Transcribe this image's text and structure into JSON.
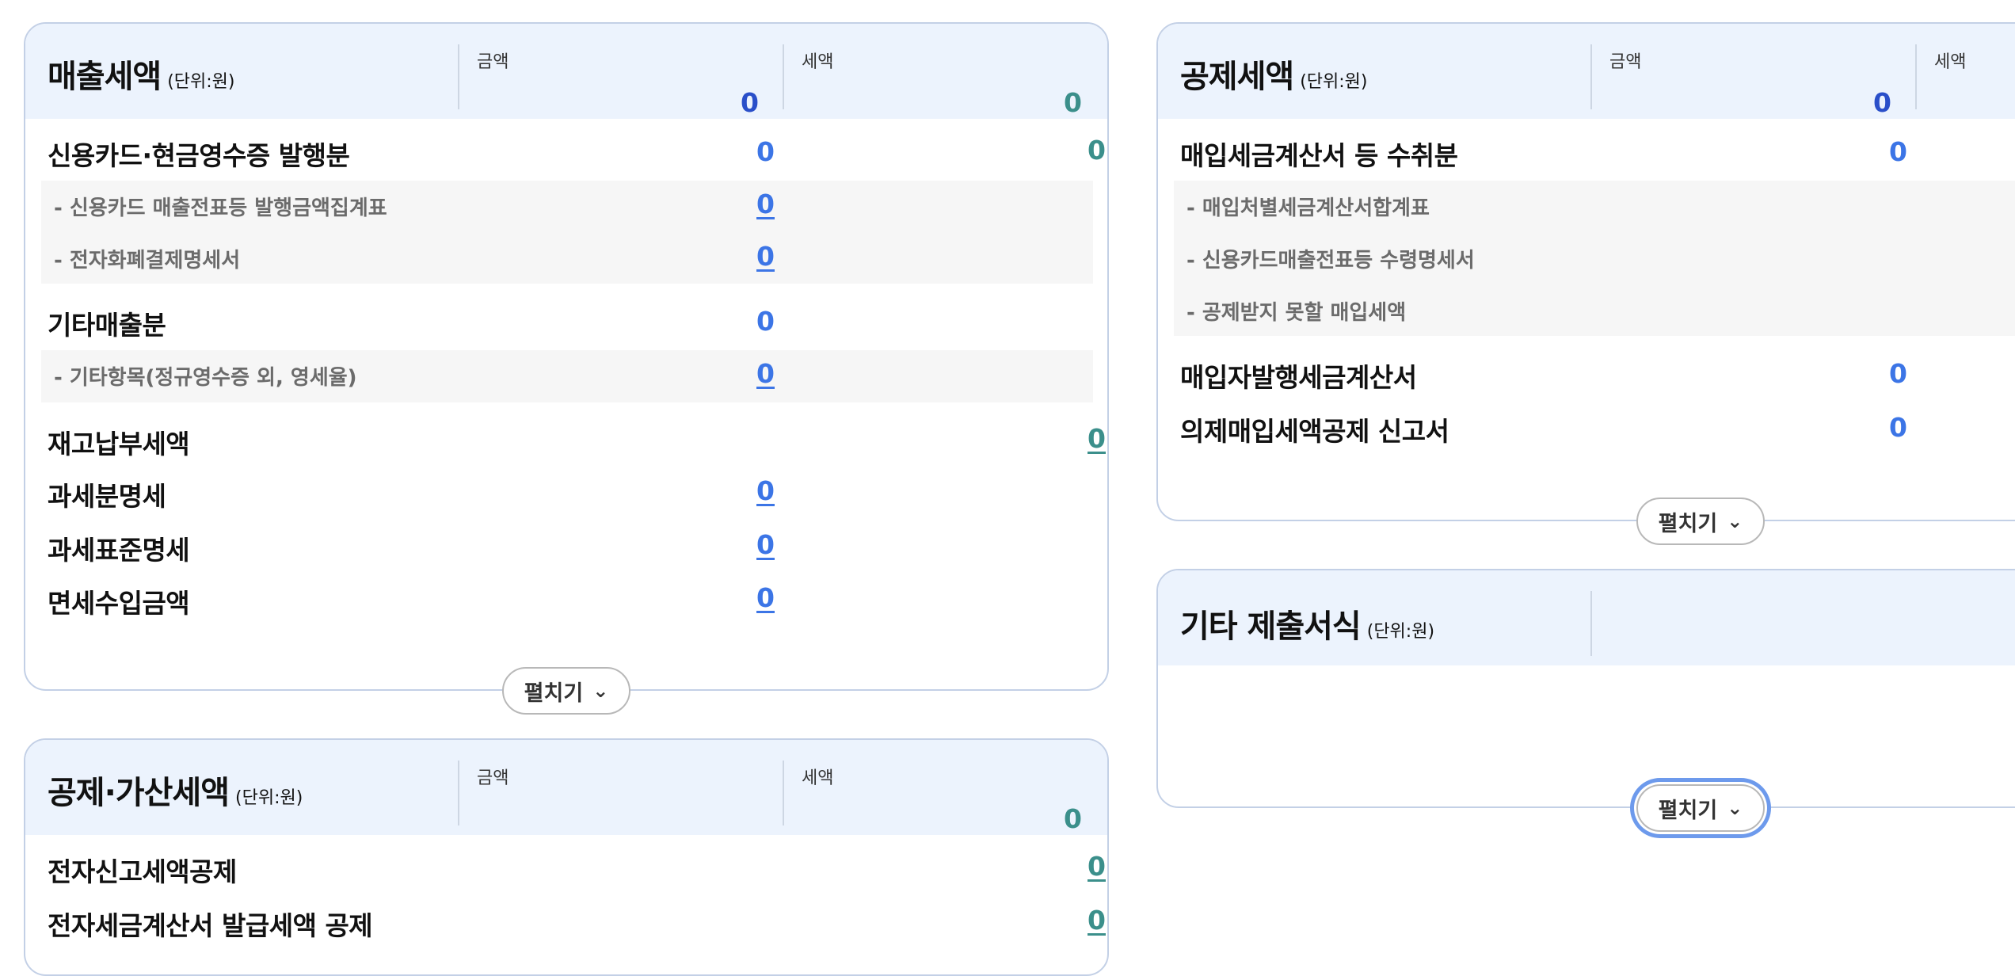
{
  "common": {
    "unit": "(단위:원)",
    "amount_label": "금액",
    "tax_label": "세액",
    "expand_label": "펼치기"
  },
  "sales_tax": {
    "title": "매출세액",
    "header_amount": "0",
    "header_tax": "0",
    "rows": [
      {
        "label": "신용카드·현금영수증 발행분",
        "amount": "0",
        "tax": "0"
      },
      {
        "label": "- 신용카드 매출전표등 발행금액집계표",
        "amount": "0"
      },
      {
        "label": "- 전자화폐결제명세서",
        "amount": "0"
      },
      {
        "label": "기타매출분",
        "amount": "0"
      },
      {
        "label": "- 기타항목(정규영수증 외, 영세율)",
        "amount": "0"
      },
      {
        "label": "재고납부세액",
        "tax": "0"
      },
      {
        "label": "과세분명세",
        "amount": "0"
      },
      {
        "label": "과세표준명세",
        "amount": "0"
      },
      {
        "label": "면세수입금액",
        "amount": "0"
      }
    ]
  },
  "deduction_add_tax": {
    "title": "공제·가산세액",
    "header_tax": "0",
    "rows": [
      {
        "label": "전자신고세액공제",
        "tax": "0"
      },
      {
        "label": "전자세금계산서 발급세액 공제",
        "tax": "0"
      }
    ]
  },
  "deduction_tax": {
    "title": "공제세액",
    "header_amount": "0",
    "rows": [
      {
        "label": "매입세금계산서 등 수취분",
        "amount": "0"
      },
      {
        "label": "- 매입처별세금계산서합계표"
      },
      {
        "label": "- 신용카드매출전표등 수령명세서"
      },
      {
        "label": "- 공제받지 못할 매입세액"
      },
      {
        "label": "매입자발행세금계산서",
        "amount": "0"
      },
      {
        "label": "의제매입세액공제 신고서",
        "amount": "0"
      }
    ]
  },
  "other_forms": {
    "title": "기타 제출서식"
  }
}
